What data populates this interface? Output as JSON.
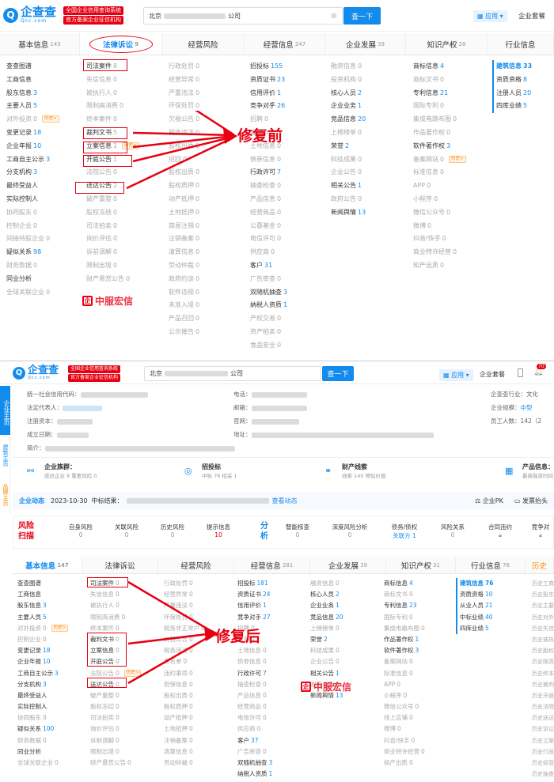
{
  "top": {
    "logo": {
      "mark": "Q",
      "name": "企查查",
      "domain": "Qcc.com",
      "badge1": "全国企业信用查询系统",
      "badge2": "官方备案企业征信机构"
    },
    "search": {
      "value_prefix": "北京",
      "value_suffix": "公司",
      "button": "查一下"
    },
    "app": "应用",
    "report": "企业套餐",
    "tabs": [
      {
        "label": "基本信息",
        "count": "145"
      },
      {
        "label": "法律诉讼",
        "count": "9"
      },
      {
        "label": "经营风险",
        "count": ""
      },
      {
        "label": "经营信息",
        "count": "247"
      },
      {
        "label": "企业发展",
        "count": "39"
      },
      {
        "label": "知识产权",
        "count": "28"
      },
      {
        "label": "行业信息",
        "count": ""
      }
    ],
    "annotation": "修复前",
    "watermark": "中服宏信",
    "hist_tag": "历史>"
  },
  "bottom": {
    "logo": {
      "mark": "Q",
      "name": "企查查",
      "domain": "Qcc.com",
      "badge1": "全国企业信用查询系统",
      "badge2": "官方备案企业征信机构"
    },
    "search": {
      "value_prefix": "北京",
      "value_suffix": "公司",
      "button": "查一下"
    },
    "app": "应用",
    "report": "企业套餐",
    "notif_count": "70",
    "side_tabs": [
      {
        "label": "企业主页"
      },
      {
        "label": "建筑主页"
      },
      {
        "label": "品牌主页"
      }
    ],
    "info": {
      "credit_code": "统一社会信用代码：",
      "legal_rep": "法定代表人：",
      "reg_capital": "注册资本：",
      "est_date": "成立日期：",
      "intro": "简介：",
      "phone": "电话：",
      "email": "邮箱：",
      "website": "官网：",
      "address": "地址：",
      "industry": "企查查行业：文化",
      "scale": "企业规模：",
      "scale_val": "中型",
      "staff": "员工人数：142（2"
    },
    "cards": [
      {
        "title": "企业族群：",
        "sub": "成员企业 8  重要风险 0"
      },
      {
        "title": "招投标",
        "sub": "中标 76  招采 1"
      },
      {
        "title": "财产线索",
        "sub": "线索 140  预估价值"
      },
      {
        "title": "产品信息：",
        "sub": "最新融资时间"
      }
    ],
    "dynamic": {
      "title": "企业动态",
      "date": "2023-10-30",
      "text": "中标结果：",
      "link": "查看动态",
      "pk": "企业PK",
      "alert": "发票抬头"
    },
    "risk": {
      "label1": "风险",
      "label2": "扫描",
      "items": [
        {
          "label": "自身风险",
          "value": "0"
        },
        {
          "label": "关联风险",
          "value": "0"
        },
        {
          "label": "历史风险",
          "value": "0"
        },
        {
          "label": "提示信息",
          "value": "10"
        }
      ]
    },
    "analysis": {
      "label1": "分",
      "label2": "析",
      "items": [
        {
          "label": "智能核查",
          "value": "0"
        },
        {
          "label": "深度风险分析",
          "value": "0"
        },
        {
          "label": "债务/债权",
          "value": "关联方 1"
        },
        {
          "label": "风险关系",
          "value": "0"
        },
        {
          "label": "合同违约",
          "value": ""
        },
        {
          "label": "竞争对",
          "value": ""
        }
      ]
    },
    "tabs": [
      {
        "label": "基本信息",
        "count": "147"
      },
      {
        "label": "法律诉讼",
        "count": ""
      },
      {
        "label": "经营风险",
        "count": ""
      },
      {
        "label": "经营信息",
        "count": "281"
      },
      {
        "label": "企业发展",
        "count": "39"
      },
      {
        "label": "知识产权",
        "count": "31"
      },
      {
        "label": "行业信息",
        "count": "76"
      },
      {
        "label": "历史",
        "count": ""
      }
    ],
    "annotation": "修复后",
    "watermark": "中服宏信",
    "hist_tag": "历史>"
  }
}
